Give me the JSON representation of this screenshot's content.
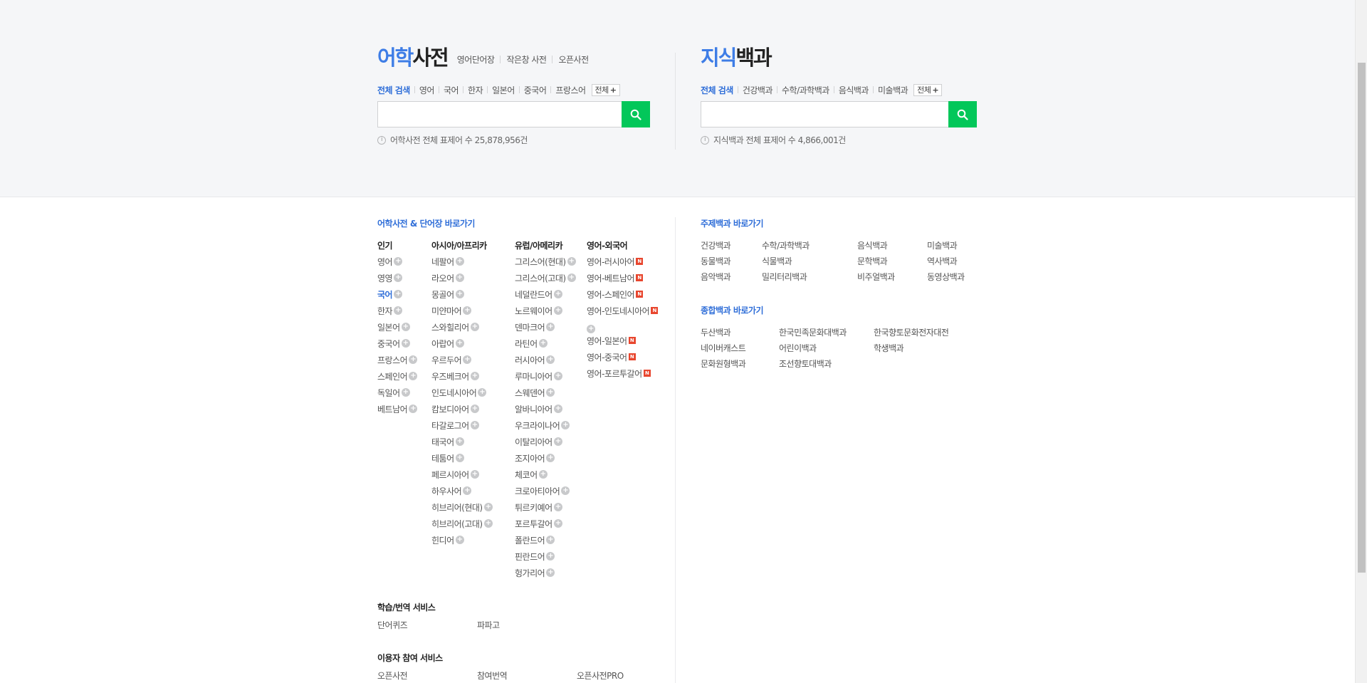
{
  "language_dict": {
    "title_blue": "어학",
    "title_dark": "사전",
    "links": [
      "영어단어장",
      "작은창 사전",
      "오픈사전"
    ],
    "tabs": [
      "전체 검색",
      "영어",
      "국어",
      "한자",
      "일본어",
      "중국어",
      "프랑스어"
    ],
    "more_label": "전체",
    "search_value": "",
    "info_text": "어학사전 전체 표제어 수 25,878,956건"
  },
  "knowledge": {
    "title_blue": "지식",
    "title_dark": "백과",
    "tabs": [
      "전체 검색",
      "건강백과",
      "수학/과학백과",
      "음식백과",
      "미술백과"
    ],
    "more_label": "전체",
    "search_value": "",
    "info_text": "지식백과 전체 표제어 수 4,866,001건"
  },
  "shortcut": {
    "title": "어학사전 & 단어장 바로가기",
    "columns": [
      {
        "header": "인기",
        "items": [
          "영어",
          "영영",
          "국어",
          "한자",
          "일본어",
          "중국어",
          "프랑스어",
          "스페인어",
          "독일어",
          "베트남어"
        ]
      },
      {
        "header": "아시아/아프리카",
        "items": [
          "네팔어",
          "라오어",
          "몽골어",
          "미얀마어",
          "스와힐리어",
          "아랍어",
          "우르두어",
          "우즈베크어",
          "인도네시아어",
          "캄보디아어",
          "타갈로그어",
          "태국어",
          "테툼어",
          "페르시아어",
          "하우사어",
          "히브리어(현대)",
          "히브리어(고대)",
          "힌디어"
        ]
      },
      {
        "header": "유럽/아메리카",
        "items": [
          "그리스어(현대)",
          "그리스어(고대)",
          "네덜란드어",
          "노르웨이어",
          "덴마크어",
          "라틴어",
          "러시아어",
          "루마니아어",
          "스웨덴어",
          "알바니아어",
          "우크라이나어",
          "이탈리아어",
          "조지아어",
          "체코어",
          "크로아티아어",
          "튀르키예어",
          "포르투갈어",
          "폴란드어",
          "핀란드어",
          "헝가리어"
        ]
      },
      {
        "header": "영어-외국어",
        "items": [
          "영어-러시아어",
          "영어-베트남어",
          "영어-스페인어",
          "영어-인도네시아어",
          "영어-일본어",
          "영어-중국어",
          "영어-포르투갈어"
        ]
      }
    ],
    "new_badge": "N",
    "plus_glyph": "+"
  },
  "learning": {
    "title": "학습/번역 서비스",
    "items": [
      "단어퀴즈",
      "파파고"
    ]
  },
  "user_services": {
    "title": "이용자 참여 서비스",
    "items": [
      "오픈사전",
      "참여번역",
      "오픈사전PRO"
    ]
  },
  "topic_encyc": {
    "title": "주제백과 바로가기",
    "items": [
      "건강백과",
      "수학/과학백과",
      "음식백과",
      "미술백과",
      "동물백과",
      "식물백과",
      "문학백과",
      "역사백과",
      "음악백과",
      "밀리터리백과",
      "비주얼백과",
      "동영상백과"
    ]
  },
  "general_encyc": {
    "title": "종합백과 바로가기",
    "items": [
      "두산백과",
      "한국민족문화대백과",
      "한국향토문화전자대전",
      "네이버캐스트",
      "어린이백과",
      "학생백과",
      "문화원형백과",
      "조선향토대백과"
    ]
  },
  "colors": {
    "accent_blue": "#3e7de6",
    "search_green": "#03c75a",
    "new_badge_red": "#e8462e"
  }
}
